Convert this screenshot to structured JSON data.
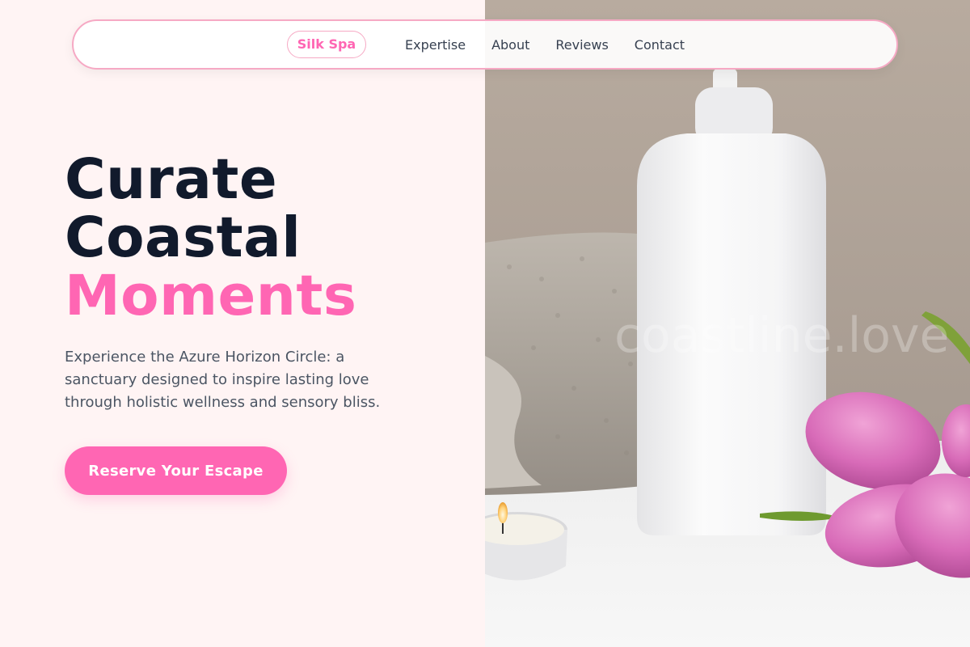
{
  "nav": {
    "brand": "Silk Spa",
    "links": [
      "Expertise",
      "About",
      "Reviews",
      "Contact"
    ]
  },
  "hero": {
    "title_line1": "Curate",
    "title_line2": "Coastal",
    "title_line3": "Moments",
    "description": "Experience the Azure Horizon Circle: a sanctuary designed to inspire lasting love through holistic wellness and sensory bliss.",
    "cta_label": "Reserve Your Escape"
  },
  "photo": {
    "watermark": "coastline.love",
    "subjects": [
      "soap-dispenser-bottle",
      "folded-towel",
      "tea-light-candle",
      "pink-tulips"
    ]
  },
  "colors": {
    "accent": "#ff66b3",
    "heading": "#111a2c",
    "body_text": "#4b5563",
    "left_background": "#fff4f4",
    "nav_border": "#f6a9c4"
  }
}
